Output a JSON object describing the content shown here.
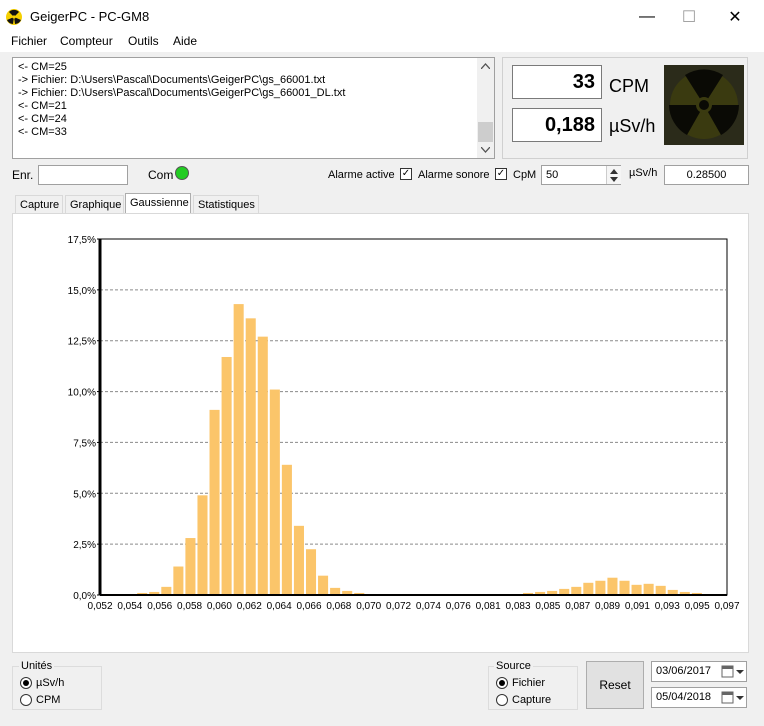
{
  "window": {
    "title": "GeigerPC  - PC-GM8",
    "minimize": "—",
    "maximize": "☐",
    "close": "✕"
  },
  "menu": [
    "Fichier",
    "Compteur",
    "Outils",
    "Aide"
  ],
  "log": {
    "lines": [
      "<- CM=25",
      "-> Fichier: D:\\Users\\Pascal\\Documents\\GeigerPC\\gs_66001.txt",
      "-> Fichier: D:\\Users\\Pascal\\Documents\\GeigerPC\\gs_66001_DL.txt",
      "<- CM=21",
      "<- CM=24",
      "<- CM=33"
    ]
  },
  "readout": {
    "cpm_value": "33",
    "cpm_unit": "CPM",
    "dose_value": "0,188",
    "dose_unit": "µSv/h"
  },
  "controls": {
    "enr_label": "Enr.",
    "enr_value": "",
    "com_label": "Com",
    "com_color": "#22cc22",
    "alarme_active_label": "Alarme active",
    "alarme_active_checked": true,
    "alarme_sonore_label": "Alarme sonore",
    "alarme_sonore_checked": true,
    "cpm_label": "CpM",
    "cpm_threshold": "50",
    "usv_label": "µSv/h",
    "usv_threshold": "0.28500"
  },
  "tabs": [
    {
      "label": "Capture",
      "active": false
    },
    {
      "label": "Graphique",
      "active": false
    },
    {
      "label": "Gaussienne",
      "active": true
    },
    {
      "label": "Statistiques",
      "active": false
    }
  ],
  "chart_data": {
    "type": "bar",
    "bar_color": "#fbc56a",
    "ylim": [
      0,
      17.5
    ],
    "yticks": [
      "0,0%",
      "2,5%",
      "5,0%",
      "7,5%",
      "10,0%",
      "12,5%",
      "15,0%",
      "17,5%"
    ],
    "xticks": [
      "0,052",
      "0,054",
      "0,056",
      "0,058",
      "0,060",
      "0,062",
      "0,064",
      "0,066",
      "0,068",
      "0,070",
      "0,072",
      "0,074",
      "0,076",
      "0,081",
      "0,083",
      "0,085",
      "0,087",
      "0,089",
      "0,091",
      "0,093",
      "0,095",
      "0,097"
    ],
    "values": [
      0.05,
      0.05,
      0.05,
      0.1,
      0.15,
      0.4,
      1.4,
      2.8,
      4.9,
      9.1,
      11.7,
      14.3,
      13.6,
      12.7,
      10.1,
      6.4,
      3.4,
      2.25,
      0.95,
      0.35,
      0.2,
      0.1,
      0.05,
      0.05,
      0.05,
      0.05,
      0.05,
      0.05,
      0.05,
      0.05,
      0.05,
      0.05,
      0.05,
      0.05,
      0.05,
      0.1,
      0.15,
      0.2,
      0.3,
      0.4,
      0.6,
      0.7,
      0.85,
      0.7,
      0.5,
      0.55,
      0.45,
      0.25,
      0.15,
      0.1,
      0.05,
      0.05
    ]
  },
  "units": {
    "title": "Unités",
    "opt1": "µSv/h",
    "opt2": "CPM",
    "selected": "µSv/h"
  },
  "source": {
    "title": "Source",
    "opt1": "Fichier",
    "opt2": "Capture",
    "selected": "Fichier"
  },
  "reset_label": "Reset",
  "dates": {
    "start": "03/06/2017",
    "end": "05/04/2018"
  }
}
